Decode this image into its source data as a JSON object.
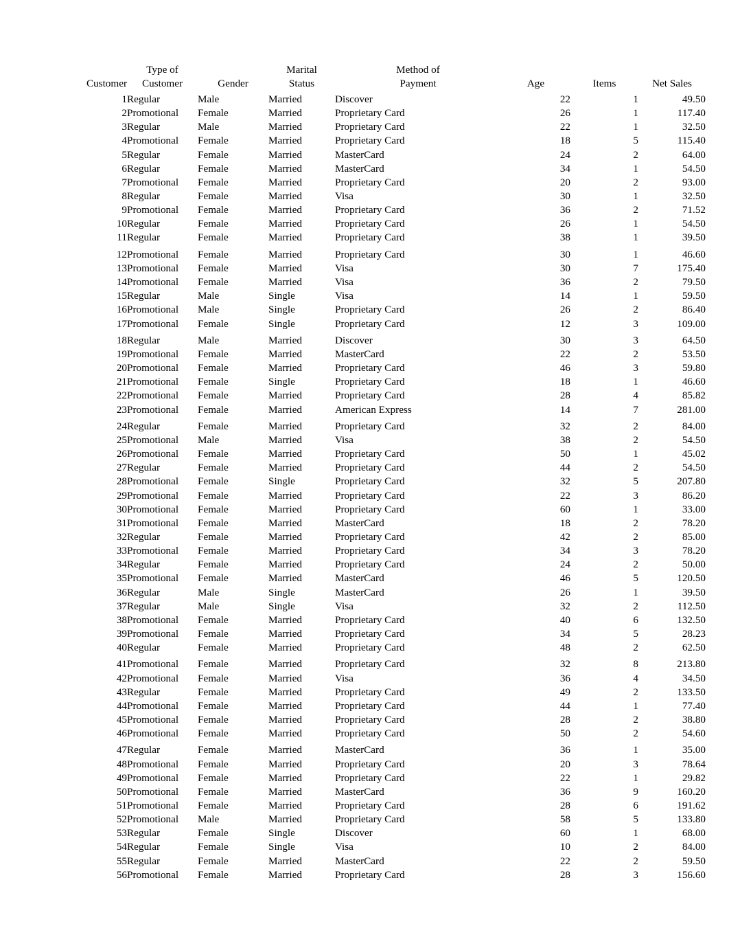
{
  "table": {
    "columns": [
      {
        "id": "customer",
        "header_lines": [
          "Customer"
        ],
        "align": "right"
      },
      {
        "id": "type",
        "header_lines": [
          "Type of",
          "Customer"
        ],
        "align": "left"
      },
      {
        "id": "gender",
        "header_lines": [
          "Gender"
        ],
        "align": "left"
      },
      {
        "id": "marital",
        "header_lines": [
          "Marital",
          "Status"
        ],
        "align": "left"
      },
      {
        "id": "payment",
        "header_lines": [
          "Method of",
          "Payment"
        ],
        "align": "left"
      },
      {
        "id": "age",
        "header_lines": [
          "Age"
        ],
        "align": "right"
      },
      {
        "id": "items",
        "header_lines": [
          "Items"
        ],
        "align": "right"
      },
      {
        "id": "sales",
        "header_lines": [
          "Net Sales"
        ],
        "align": "right"
      }
    ],
    "header": {
      "customer": "Customer",
      "type_line1": "Type of",
      "type_line2": "Customer",
      "gender": "Gender",
      "marital_line1": "Marital",
      "marital_line2": "Status",
      "payment_line1": "Method of",
      "payment_line2": "Payment",
      "age": "Age",
      "items": "Items",
      "sales": "Net Sales"
    },
    "row_count": 56,
    "rows": [
      {
        "customer": "1",
        "type": "Regular",
        "gender": "Male",
        "marital": "Married",
        "payment": "Discover",
        "age": "22",
        "items": "1",
        "sales": "49.50",
        "gap": false
      },
      {
        "customer": "2",
        "type": "Promotional",
        "gender": "Female",
        "marital": "Married",
        "payment": "Proprietary Card",
        "age": "26",
        "items": "1",
        "sales": "117.40",
        "gap": false
      },
      {
        "customer": "3",
        "type": "Regular",
        "gender": "Male",
        "marital": "Married",
        "payment": "Proprietary Card",
        "age": "22",
        "items": "1",
        "sales": "32.50",
        "gap": false
      },
      {
        "customer": "4",
        "type": "Promotional",
        "gender": "Female",
        "marital": "Married",
        "payment": "Proprietary Card",
        "age": "18",
        "items": "5",
        "sales": "115.40",
        "gap": false
      },
      {
        "customer": "5",
        "type": "Regular",
        "gender": "Female",
        "marital": "Married",
        "payment": "MasterCard",
        "age": "24",
        "items": "2",
        "sales": "64.00",
        "gap": false
      },
      {
        "customer": "6",
        "type": "Regular",
        "gender": "Female",
        "marital": "Married",
        "payment": "MasterCard",
        "age": "34",
        "items": "1",
        "sales": "54.50",
        "gap": false
      },
      {
        "customer": "7",
        "type": "Promotional",
        "gender": "Female",
        "marital": "Married",
        "payment": "Proprietary Card",
        "age": "20",
        "items": "2",
        "sales": "93.00",
        "gap": false
      },
      {
        "customer": "8",
        "type": "Regular",
        "gender": "Female",
        "marital": "Married",
        "payment": "Visa",
        "age": "30",
        "items": "1",
        "sales": "32.50",
        "gap": false
      },
      {
        "customer": "9",
        "type": "Promotional",
        "gender": "Female",
        "marital": "Married",
        "payment": "Proprietary Card",
        "age": "36",
        "items": "2",
        "sales": "71.52",
        "gap": false
      },
      {
        "customer": "10",
        "type": "Regular",
        "gender": "Female",
        "marital": "Married",
        "payment": "Proprietary Card",
        "age": "26",
        "items": "1",
        "sales": "54.50",
        "gap": false
      },
      {
        "customer": "11",
        "type": "Regular",
        "gender": "Female",
        "marital": "Married",
        "payment": "Proprietary Card",
        "age": "38",
        "items": "1",
        "sales": "39.50",
        "gap": false
      },
      {
        "customer": "12",
        "type": "Promotional",
        "gender": "Female",
        "marital": "Married",
        "payment": "Proprietary Card",
        "age": "30",
        "items": "1",
        "sales": "46.60",
        "gap": true
      },
      {
        "customer": "13",
        "type": "Promotional",
        "gender": "Female",
        "marital": "Married",
        "payment": "Visa",
        "age": "30",
        "items": "7",
        "sales": "175.40",
        "gap": false
      },
      {
        "customer": "14",
        "type": "Promotional",
        "gender": "Female",
        "marital": "Married",
        "payment": "Visa",
        "age": "36",
        "items": "2",
        "sales": "79.50",
        "gap": false
      },
      {
        "customer": "15",
        "type": "Regular",
        "gender": "Male",
        "marital": "Single",
        "payment": "Visa",
        "age": "14",
        "items": "1",
        "sales": "59.50",
        "gap": false
      },
      {
        "customer": "16",
        "type": "Promotional",
        "gender": "Male",
        "marital": "Single",
        "payment": "Proprietary Card",
        "age": "26",
        "items": "2",
        "sales": "86.40",
        "gap": false
      },
      {
        "customer": "17",
        "type": "Promotional",
        "gender": "Female",
        "marital": "Single",
        "payment": "Proprietary Card",
        "age": "12",
        "items": "3",
        "sales": "109.00",
        "gap": false
      },
      {
        "customer": "18",
        "type": "Regular",
        "gender": "Male",
        "marital": "Married",
        "payment": "Discover",
        "age": "30",
        "items": "3",
        "sales": "64.50",
        "gap": true
      },
      {
        "customer": "19",
        "type": "Promotional",
        "gender": "Female",
        "marital": "Married",
        "payment": "MasterCard",
        "age": "22",
        "items": "2",
        "sales": "53.50",
        "gap": false
      },
      {
        "customer": "20",
        "type": "Promotional",
        "gender": "Female",
        "marital": "Married",
        "payment": "Proprietary Card",
        "age": "46",
        "items": "3",
        "sales": "59.80",
        "gap": false
      },
      {
        "customer": "21",
        "type": "Promotional",
        "gender": "Female",
        "marital": "Single",
        "payment": "Proprietary Card",
        "age": "18",
        "items": "1",
        "sales": "46.60",
        "gap": false
      },
      {
        "customer": "22",
        "type": "Promotional",
        "gender": "Female",
        "marital": "Married",
        "payment": "Proprietary Card",
        "age": "28",
        "items": "4",
        "sales": "85.82",
        "gap": false
      },
      {
        "customer": "23",
        "type": "Promotional",
        "gender": "Female",
        "marital": "Married",
        "payment": "American Express",
        "age": "14",
        "items": "7",
        "sales": "281.00",
        "gap": false
      },
      {
        "customer": "24",
        "type": "Regular",
        "gender": "Female",
        "marital": "Married",
        "payment": "Proprietary Card",
        "age": "32",
        "items": "2",
        "sales": "84.00",
        "gap": true
      },
      {
        "customer": "25",
        "type": "Promotional",
        "gender": "Male",
        "marital": "Married",
        "payment": "Visa",
        "age": "38",
        "items": "2",
        "sales": "54.50",
        "gap": false
      },
      {
        "customer": "26",
        "type": "Promotional",
        "gender": "Female",
        "marital": "Married",
        "payment": "Proprietary Card",
        "age": "50",
        "items": "1",
        "sales": "45.02",
        "gap": false
      },
      {
        "customer": "27",
        "type": "Regular",
        "gender": "Female",
        "marital": "Married",
        "payment": "Proprietary Card",
        "age": "44",
        "items": "2",
        "sales": "54.50",
        "gap": false
      },
      {
        "customer": "28",
        "type": "Promotional",
        "gender": "Female",
        "marital": "Single",
        "payment": "Proprietary Card",
        "age": "32",
        "items": "5",
        "sales": "207.80",
        "gap": false
      },
      {
        "customer": "29",
        "type": "Promotional",
        "gender": "Female",
        "marital": "Married",
        "payment": "Proprietary Card",
        "age": "22",
        "items": "3",
        "sales": "86.20",
        "gap": false
      },
      {
        "customer": "30",
        "type": "Promotional",
        "gender": "Female",
        "marital": "Married",
        "payment": "Proprietary Card",
        "age": "60",
        "items": "1",
        "sales": "33.00",
        "gap": false
      },
      {
        "customer": "31",
        "type": "Promotional",
        "gender": "Female",
        "marital": "Married",
        "payment": "MasterCard",
        "age": "18",
        "items": "2",
        "sales": "78.20",
        "gap": false
      },
      {
        "customer": "32",
        "type": "Regular",
        "gender": "Female",
        "marital": "Married",
        "payment": "Proprietary Card",
        "age": "42",
        "items": "2",
        "sales": "85.00",
        "gap": false
      },
      {
        "customer": "33",
        "type": "Promotional",
        "gender": "Female",
        "marital": "Married",
        "payment": "Proprietary Card",
        "age": "34",
        "items": "3",
        "sales": "78.20",
        "gap": false
      },
      {
        "customer": "34",
        "type": "Regular",
        "gender": "Female",
        "marital": "Married",
        "payment": "Proprietary Card",
        "age": "24",
        "items": "2",
        "sales": "50.00",
        "gap": false
      },
      {
        "customer": "35",
        "type": "Promotional",
        "gender": "Female",
        "marital": "Married",
        "payment": "MasterCard",
        "age": "46",
        "items": "5",
        "sales": "120.50",
        "gap": false
      },
      {
        "customer": "36",
        "type": "Regular",
        "gender": "Male",
        "marital": "Single",
        "payment": "MasterCard",
        "age": "26",
        "items": "1",
        "sales": "39.50",
        "gap": false
      },
      {
        "customer": "37",
        "type": "Regular",
        "gender": "Male",
        "marital": "Single",
        "payment": "Visa",
        "age": "32",
        "items": "2",
        "sales": "112.50",
        "gap": false
      },
      {
        "customer": "38",
        "type": "Promotional",
        "gender": "Female",
        "marital": "Married",
        "payment": "Proprietary Card",
        "age": "40",
        "items": "6",
        "sales": "132.50",
        "gap": false
      },
      {
        "customer": "39",
        "type": "Promotional",
        "gender": "Female",
        "marital": "Married",
        "payment": "Proprietary Card",
        "age": "34",
        "items": "5",
        "sales": "28.23",
        "gap": false
      },
      {
        "customer": "40",
        "type": "Regular",
        "gender": "Female",
        "marital": "Married",
        "payment": "Proprietary Card",
        "age": "48",
        "items": "2",
        "sales": "62.50",
        "gap": false
      },
      {
        "customer": "41",
        "type": "Promotional",
        "gender": "Female",
        "marital": "Married",
        "payment": "Proprietary Card",
        "age": "32",
        "items": "8",
        "sales": "213.80",
        "gap": true
      },
      {
        "customer": "42",
        "type": "Promotional",
        "gender": "Female",
        "marital": "Married",
        "payment": "Visa",
        "age": "36",
        "items": "4",
        "sales": "34.50",
        "gap": false
      },
      {
        "customer": "43",
        "type": "Regular",
        "gender": "Female",
        "marital": "Married",
        "payment": "Proprietary Card",
        "age": "49",
        "items": "2",
        "sales": "133.50",
        "gap": false
      },
      {
        "customer": "44",
        "type": "Promotional",
        "gender": "Female",
        "marital": "Married",
        "payment": "Proprietary Card",
        "age": "44",
        "items": "1",
        "sales": "77.40",
        "gap": false
      },
      {
        "customer": "45",
        "type": "Promotional",
        "gender": "Female",
        "marital": "Married",
        "payment": "Proprietary Card",
        "age": "28",
        "items": "2",
        "sales": "38.80",
        "gap": false
      },
      {
        "customer": "46",
        "type": "Promotional",
        "gender": "Female",
        "marital": "Married",
        "payment": "Proprietary Card",
        "age": "50",
        "items": "2",
        "sales": "54.60",
        "gap": false
      },
      {
        "customer": "47",
        "type": "Regular",
        "gender": "Female",
        "marital": "Married",
        "payment": "MasterCard",
        "age": "36",
        "items": "1",
        "sales": "35.00",
        "gap": true
      },
      {
        "customer": "48",
        "type": "Promotional",
        "gender": "Female",
        "marital": "Married",
        "payment": "Proprietary Card",
        "age": "20",
        "items": "3",
        "sales": "78.64",
        "gap": false
      },
      {
        "customer": "49",
        "type": "Promotional",
        "gender": "Female",
        "marital": "Married",
        "payment": "Proprietary Card",
        "age": "22",
        "items": "1",
        "sales": "29.82",
        "gap": false
      },
      {
        "customer": "50",
        "type": "Promotional",
        "gender": "Female",
        "marital": "Married",
        "payment": "MasterCard",
        "age": "36",
        "items": "9",
        "sales": "160.20",
        "gap": false
      },
      {
        "customer": "51",
        "type": "Promotional",
        "gender": "Female",
        "marital": "Married",
        "payment": "Proprietary Card",
        "age": "28",
        "items": "6",
        "sales": "191.62",
        "gap": false
      },
      {
        "customer": "52",
        "type": "Promotional",
        "gender": "Male",
        "marital": "Married",
        "payment": "Proprietary Card",
        "age": "58",
        "items": "5",
        "sales": "133.80",
        "gap": false
      },
      {
        "customer": "53",
        "type": "Regular",
        "gender": "Female",
        "marital": "Single",
        "payment": "Discover",
        "age": "60",
        "items": "1",
        "sales": "68.00",
        "gap": false
      },
      {
        "customer": "54",
        "type": "Regular",
        "gender": "Female",
        "marital": "Single",
        "payment": "Visa",
        "age": "10",
        "items": "2",
        "sales": "84.00",
        "gap": false
      },
      {
        "customer": "55",
        "type": "Regular",
        "gender": "Female",
        "marital": "Married",
        "payment": "MasterCard",
        "age": "22",
        "items": "2",
        "sales": "59.50",
        "gap": false
      },
      {
        "customer": "56",
        "type": "Promotional",
        "gender": "Female",
        "marital": "Married",
        "payment": "Proprietary Card",
        "age": "28",
        "items": "3",
        "sales": "156.60",
        "gap": false
      }
    ]
  }
}
